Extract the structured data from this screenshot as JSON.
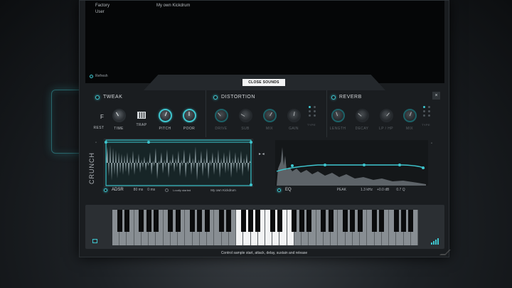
{
  "browser": {
    "categories": [
      "Factory",
      "User"
    ],
    "presets": [
      "My own Kickdrum"
    ],
    "refresh_label": "Refresh"
  },
  "close_sounds_label": "CLOSE SOUNDS",
  "tweak": {
    "title": "TWEAK",
    "f_label": "F",
    "knobs": [
      "REST",
      "TIME",
      "TRAP",
      "PITCH",
      "POOR"
    ]
  },
  "distortion": {
    "title": "DISTORTION",
    "knobs": [
      "DRIVE",
      "SUB",
      "MIX",
      "GAIN"
    ],
    "type_label": "TYPE"
  },
  "reverb": {
    "title": "REVERB",
    "knobs": [
      "LENGTH",
      "DECAY",
      "LP / HP",
      "MIX"
    ],
    "type_label": "TYPE"
  },
  "close_icon": "close-icon",
  "wave": {
    "title": "CRUNCH"
  },
  "adsr": {
    "title": "ADSR",
    "attack": "80 ms",
    "decay": "0 ms",
    "loop_label": "Loudly started",
    "sample_name": "My own Kickdrum"
  },
  "eq": {
    "title": "EQ",
    "band_type": "PEAK",
    "freq": "1.3 kHz",
    "gain": "+0.0 dB",
    "q": "0.7 Q"
  },
  "status_text": "Control sample start, attack, delay, sustain and release",
  "colors": {
    "accent": "#3ec6cf",
    "panel": "#1a1d20",
    "background": "#0c0e10"
  }
}
